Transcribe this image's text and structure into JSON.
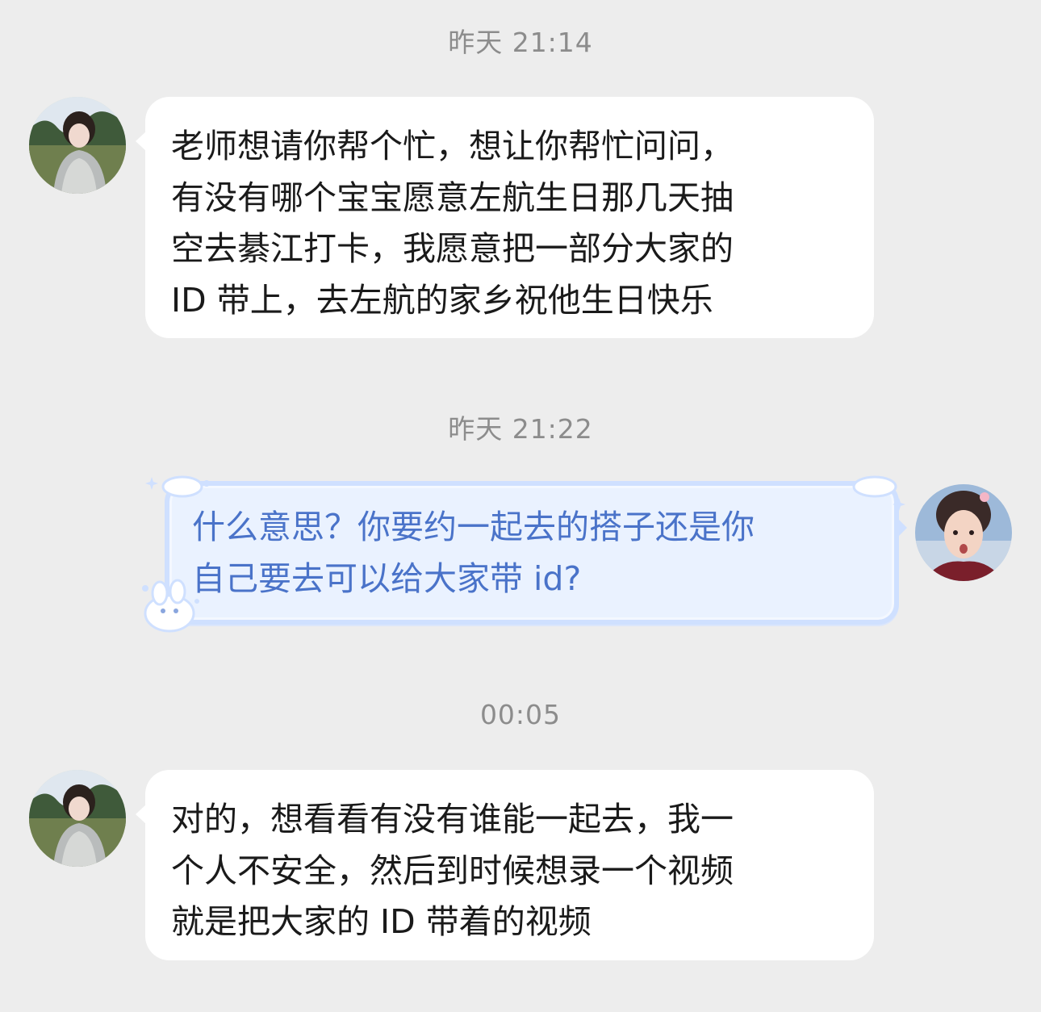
{
  "messages": [
    {
      "timestamp": "昨天 21:14",
      "sender": "contact",
      "avatar": "contact-avatar",
      "lines": [
        "老师想请你帮个忙，想让你帮忙问问，",
        "有没有哪个宝宝愿意左航生日那几天抽",
        "空去綦江打卡，我愿意把一部分大家的",
        " ID 带上，去左航的家乡祝他生日快乐"
      ]
    },
    {
      "timestamp": "昨天 21:22",
      "sender": "self",
      "avatar": "self-avatar",
      "lines": [
        "什么意思？你要约一起去的搭子还是你",
        "自己要去可以给大家带 id?"
      ]
    },
    {
      "timestamp": "00:05",
      "sender": "contact",
      "avatar": "contact-avatar",
      "lines": [
        "对的，想看看有没有谁能一起去，我一",
        "个人不安全，然后到时候想录一个视频",
        "就是把大家的 ID 带着的视频"
      ]
    }
  ],
  "colors": {
    "background": "#ededed",
    "incoming_bubble": "#ffffff",
    "outgoing_bubble": "#eaf2ff",
    "outgoing_border": "#cfe0ff",
    "outgoing_text": "#4a73c9",
    "timestamp_text": "#8c8c8c"
  }
}
